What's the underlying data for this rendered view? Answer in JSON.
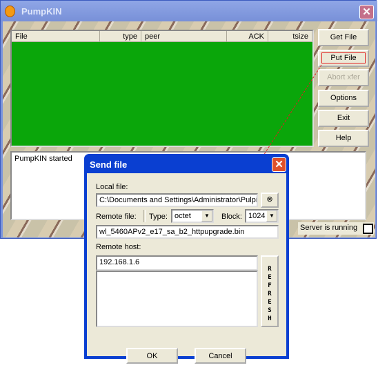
{
  "main": {
    "title": "PumpKIN",
    "columns": [
      "File",
      "type",
      "peer",
      "ACK",
      "tsize"
    ],
    "buttons": {
      "get": "Get File",
      "put": "Put File",
      "abort": "Abort xfer",
      "options": "Options",
      "exit": "Exit",
      "help": "Help"
    },
    "log": "PumpKIN started",
    "status": "Server is running",
    "list_color": "#0aa60a"
  },
  "dialog": {
    "title": "Send file",
    "local_label": "Local file:",
    "local_value": "C:\\Documents and Settings\\Administrator\\Pulpit",
    "remote_label": "Remote file:",
    "type_label": "Type:",
    "type_value": "octet",
    "block_label": "Block:",
    "block_value": "1024",
    "remote_value": "wl_5460APv2_e17_sa_b2_httpupgrade.bin",
    "host_label": "Remote host:",
    "host_value": "192.168.1.6",
    "refresh": "REFRESH",
    "ok": "OK",
    "cancel": "Cancel"
  }
}
